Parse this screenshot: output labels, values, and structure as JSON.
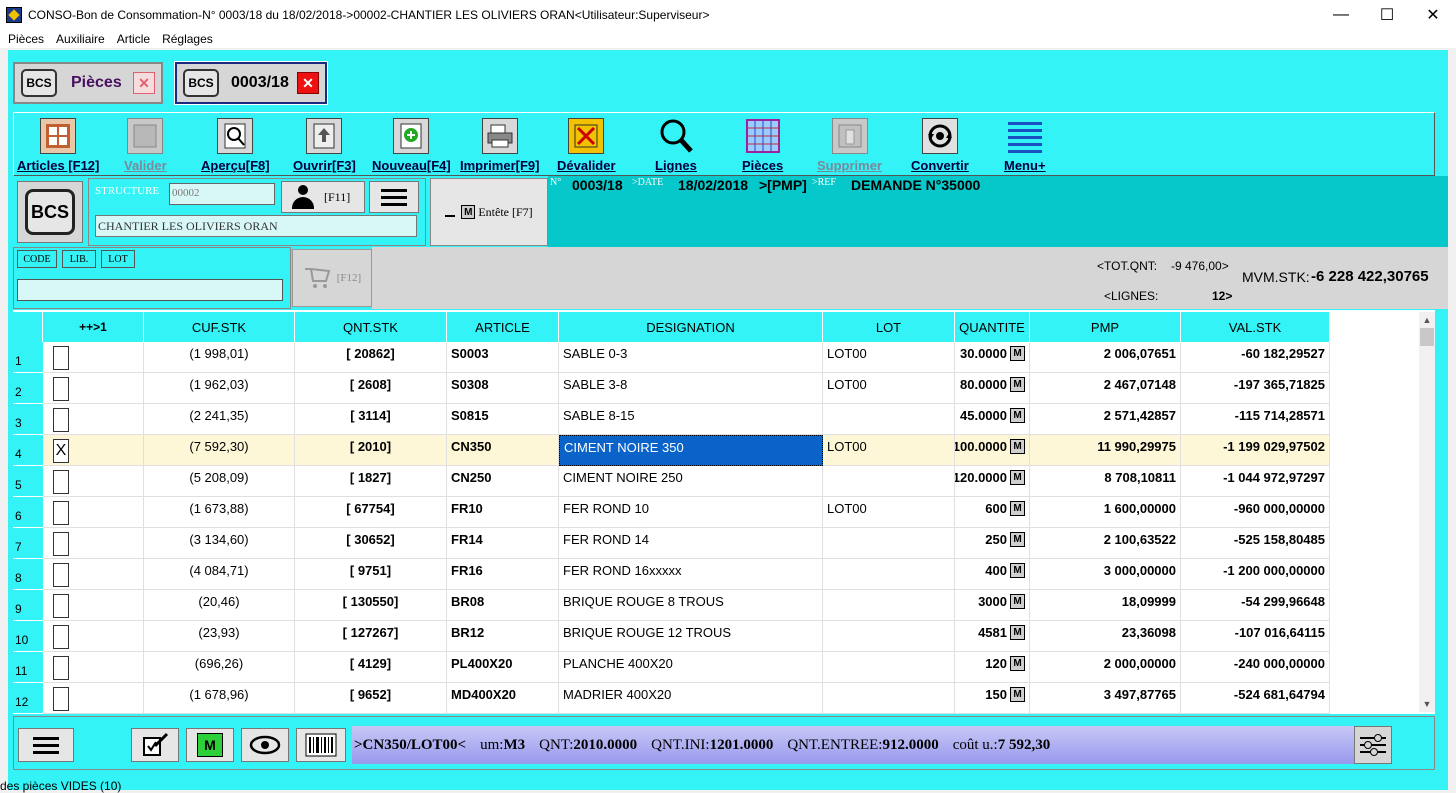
{
  "window": {
    "title": "CONSO-Bon de Consommation-N° 0003/18 du 18/02/2018->00002-CHANTIER LES OLIVIERS ORAN<Utilisateur:Superviseur>",
    "minimize": "—",
    "maximize": "☐",
    "close": "✕"
  },
  "menu": [
    "Pièces",
    "Auxiliaire",
    "Article",
    "Réglages"
  ],
  "tabs": {
    "pieces": {
      "icon_text": "BCS",
      "label": "Pièces",
      "close": "✕"
    },
    "doc": {
      "icon_text": "BCS",
      "label": "0003/18",
      "close": "✕"
    }
  },
  "toolbar": {
    "articles": "Articles [F12]",
    "valider": "Valider",
    "apercu": "Aperçu[F8]",
    "ouvrir": "Ouvrir[F3]",
    "nouveau": "Nouveau[F4]",
    "imprimer": "Imprimer[F9]",
    "devalider": "Dévalider",
    "lignes": "Lignes",
    "pieces": "Pièces",
    "supprimer": "Supprimer",
    "convertir": "Convertir",
    "menu_plus": "Menu+"
  },
  "structure": {
    "bcs_icon": "BCS",
    "label": "STRUCTURE",
    "code": "00002",
    "name": "CHANTIER LES OLIVIERS ORAN",
    "user_key": "[F11]",
    "entete_m": "M",
    "entete": "Entête [F7]"
  },
  "doc_header": {
    "n_label": "N°",
    "number": "0003/18",
    "date_label": ">DATE",
    "date": "18/02/2018",
    "pmp": ">[PMP]",
    "ref_label": ">REF",
    "ref": "DEMANDE N°35000"
  },
  "search": {
    "tabs": [
      "CODE",
      "LIB.",
      "LOT"
    ],
    "value": "",
    "cart_key": "[F12]"
  },
  "totals": {
    "tot_qnt_label": "<TOT.QNT:",
    "tot_qnt_value": "-9 476,00>",
    "lignes_label": "<LIGNES:",
    "lignes_value": "12>",
    "mvm_label": "MVM.STK:",
    "mvm_value": "-6 228 422,30765"
  },
  "grid": {
    "headers": [
      "++>1",
      "CUF.STK",
      "QNT.STK",
      "ARTICLE",
      "DESIGNATION",
      "LOT",
      "QUANTITE",
      "PMP",
      "VAL.STK"
    ],
    "rows": [
      {
        "n": "1",
        "chk": "",
        "cuf": "(1 998,01)",
        "qnt": "[ 20862]",
        "article": "S0003",
        "desig": "SABLE 0-3",
        "lot": "LOT00",
        "quantite": "30.0000",
        "m": "M",
        "pmp": "2 006,07651",
        "val": "-60 182,29527"
      },
      {
        "n": "2",
        "chk": "",
        "cuf": "(1 962,03)",
        "qnt": "[ 2608]",
        "article": "S0308",
        "desig": "SABLE 3-8",
        "lot": "LOT00",
        "quantite": "80.0000",
        "m": "M",
        "pmp": "2 467,07148",
        "val": "-197 365,71825"
      },
      {
        "n": "3",
        "chk": "",
        "cuf": "(2 241,35)",
        "qnt": "[ 3114]",
        "article": "S0815",
        "desig": "SABLE 8-15",
        "lot": "",
        "quantite": "45.0000",
        "m": "M",
        "pmp": "2 571,42857",
        "val": "-115 714,28571"
      },
      {
        "n": "4",
        "chk": "X",
        "cuf": "(7 592,30)",
        "qnt": "[ 2010]",
        "article": "CN350",
        "desig": "CIMENT NOIRE 350",
        "lot": "LOT00",
        "quantite": "100.0000",
        "m": "M",
        "pmp": "11 990,29975",
        "val": "-1 199 029,97502"
      },
      {
        "n": "5",
        "chk": "",
        "cuf": "(5 208,09)",
        "qnt": "[ 1827]",
        "article": "CN250",
        "desig": "CIMENT NOIRE 250",
        "lot": "",
        "quantite": "120.0000",
        "m": "M",
        "pmp": "8 708,10811",
        "val": "-1 044 972,97297"
      },
      {
        "n": "6",
        "chk": "",
        "cuf": "(1 673,88)",
        "qnt": "[ 67754]",
        "article": "FR10",
        "desig": "FER ROND 10",
        "lot": "LOT00",
        "quantite": "600",
        "m": "M",
        "pmp": "1 600,00000",
        "val": "-960 000,00000"
      },
      {
        "n": "7",
        "chk": "",
        "cuf": "(3 134,60)",
        "qnt": "[ 30652]",
        "article": "FR14",
        "desig": "FER ROND 14",
        "lot": "",
        "quantite": "250",
        "m": "M",
        "pmp": "2 100,63522",
        "val": "-525 158,80485"
      },
      {
        "n": "8",
        "chk": "",
        "cuf": "(4 084,71)",
        "qnt": "[ 9751]",
        "article": "FR16",
        "desig": "FER ROND 16xxxxx",
        "lot": "",
        "quantite": "400",
        "m": "M",
        "pmp": "3 000,00000",
        "val": "-1 200 000,00000"
      },
      {
        "n": "9",
        "chk": "",
        "cuf": "(20,46)",
        "qnt": "[ 130550]",
        "article": "BR08",
        "desig": "BRIQUE ROUGE 8 TROUS",
        "lot": "",
        "quantite": "3000",
        "m": "M",
        "pmp": "18,09999",
        "val": "-54 299,96648"
      },
      {
        "n": "10",
        "chk": "",
        "cuf": "(23,93)",
        "qnt": "[ 127267]",
        "article": "BR12",
        "desig": "BRIQUE ROUGE 12 TROUS",
        "lot": "",
        "quantite": "4581",
        "m": "M",
        "pmp": "23,36098",
        "val": "-107 016,64115"
      },
      {
        "n": "11",
        "chk": "",
        "cuf": "(696,26)",
        "qnt": "[ 4129]",
        "article": "PL400X20",
        "desig": "PLANCHE 400X20",
        "lot": "",
        "quantite": "120",
        "m": "M",
        "pmp": "2 000,00000",
        "val": "-240 000,00000"
      },
      {
        "n": "12",
        "chk": "",
        "cuf": "(1 678,96)",
        "qnt": "[ 9652]",
        "article": "MD400X20",
        "desig": "MADRIER 400X20",
        "lot": "",
        "quantite": "150",
        "m": "M",
        "pmp": "3 497,87765",
        "val": "-524 681,64794"
      }
    ]
  },
  "bottom": {
    "m_label": "M",
    "ref": ">CN350/LOT00<",
    "um_label": "um:",
    "um": "M3",
    "qnt_label": "QNT:",
    "qnt": "2010.0000",
    "qnt_ini_label": "QNT.INI:",
    "qnt_ini": "1201.0000",
    "qnt_entree_label": "QNT.ENTREE:",
    "qnt_entree": "912.0000",
    "cout_label": "coût u.:",
    "cout": "7 592,30"
  },
  "footer": "des pièces VIDES (10)",
  "colors": {
    "cyan": "#33f3f6",
    "teal": "#06c7c9",
    "selected": "#0a63c9"
  }
}
